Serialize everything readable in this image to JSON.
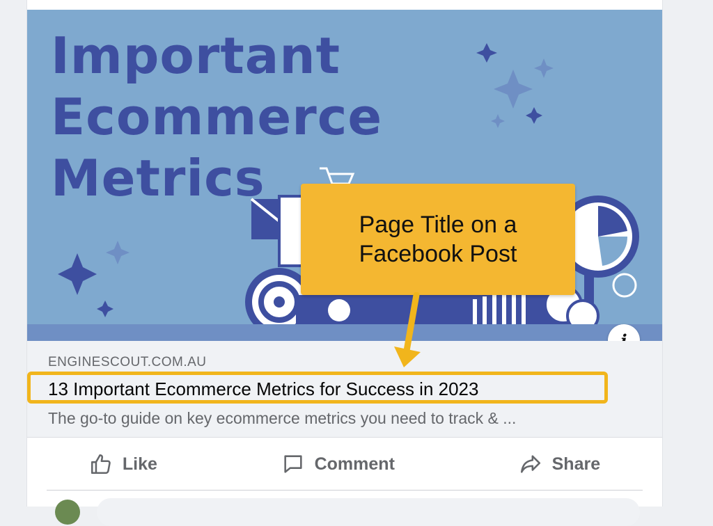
{
  "banner": {
    "title_lines": [
      "Important",
      "Ecommerce",
      "Metrics"
    ]
  },
  "callout": {
    "text": "Page Title on a Facebook Post"
  },
  "link": {
    "domain": "ENGINESCOUT.COM.AU",
    "title": "13 Important Ecommerce Metrics for Success in 2023",
    "description": "The go-to guide on key ecommerce metrics you need to track & ..."
  },
  "actions": {
    "like": "Like",
    "comment": "Comment",
    "share": "Share"
  },
  "colors": {
    "banner_bg": "#7fa9cf",
    "banner_text": "#3e4fa0",
    "callout_bg": "#f4b731",
    "highlight": "#f1b51c"
  },
  "icons": [
    "info-icon",
    "like-icon",
    "comment-icon",
    "share-icon"
  ]
}
